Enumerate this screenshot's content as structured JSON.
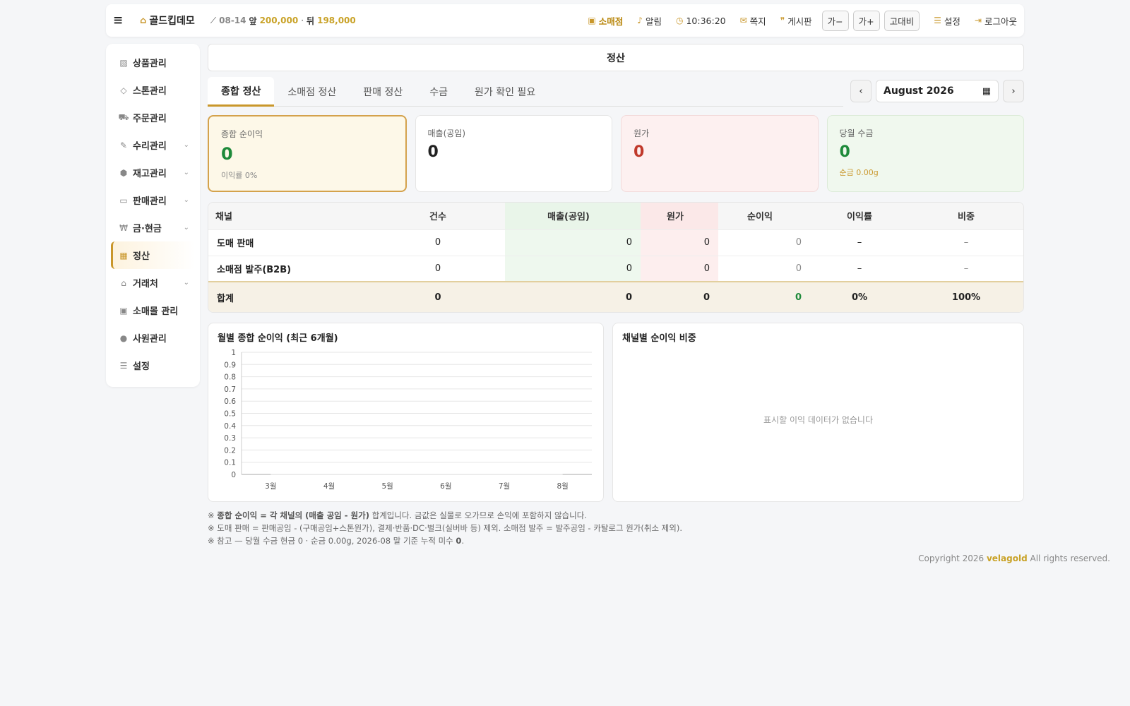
{
  "topbar": {
    "brand": "골드킵데모",
    "ticker": {
      "date": "08-14",
      "front_label": "앞",
      "front_value": "200,000",
      "sep": "·",
      "back_label": "뒤",
      "back_value": "198,000"
    },
    "store": "소매점",
    "alerts": "알림",
    "time": "10:36:20",
    "messages": "쪽지",
    "board": "게시판",
    "font_minus": "가−",
    "font_plus": "가+",
    "contrast": "고대비",
    "settings": "설정",
    "logout": "로그아웃"
  },
  "sidebar": {
    "items": [
      {
        "label": "상품관리",
        "icon": "image-icon",
        "glyph": "▨",
        "expandable": false
      },
      {
        "label": "스톤관리",
        "icon": "gem-icon",
        "glyph": "◇",
        "expandable": false
      },
      {
        "label": "주문관리",
        "icon": "cart-icon",
        "glyph": "⛟",
        "expandable": false
      },
      {
        "label": "수리관리",
        "icon": "wrench-icon",
        "glyph": "✎",
        "expandable": true
      },
      {
        "label": "재고관리",
        "icon": "boxes-icon",
        "glyph": "⬢",
        "expandable": true
      },
      {
        "label": "판매관리",
        "icon": "card-icon",
        "glyph": "▭",
        "expandable": true
      },
      {
        "label": "금·현금",
        "icon": "won-icon",
        "glyph": "₩",
        "expandable": true
      },
      {
        "label": "정산",
        "icon": "calculator-icon",
        "glyph": "▦",
        "expandable": false,
        "active": true
      },
      {
        "label": "거래처",
        "icon": "bank-icon",
        "glyph": "⌂",
        "expandable": true
      },
      {
        "label": "소매몰 관리",
        "icon": "shop-icon",
        "glyph": "▣",
        "expandable": false
      },
      {
        "label": "사원관리",
        "icon": "person-icon",
        "glyph": "●",
        "expandable": false
      },
      {
        "label": "설정",
        "icon": "sliders-icon",
        "glyph": "☰",
        "expandable": false
      }
    ]
  },
  "main": {
    "title": "정산",
    "tabs": [
      "종합 정산",
      "소매점 정산",
      "판매 정산",
      "수금",
      "원가 확인 필요"
    ],
    "month": "August 2026",
    "cards": {
      "net_profit": {
        "label": "종합 순이익",
        "value": "0",
        "sub": "이익률 0%"
      },
      "sales": {
        "label": "매출(공임)",
        "value": "0"
      },
      "cost": {
        "label": "원가",
        "value": "0"
      },
      "collection": {
        "label": "당월 수금",
        "value": "0",
        "sub": "순금 0.00g"
      }
    },
    "table": {
      "headers": [
        "채널",
        "건수",
        "매출(공임)",
        "원가",
        "순이익",
        "이익률",
        "비중"
      ],
      "rows": [
        [
          "도매 판매",
          "0",
          "0",
          "0",
          "0",
          "–",
          "–"
        ],
        [
          "소매점 발주(B2B)",
          "0",
          "0",
          "0",
          "0",
          "–",
          "–"
        ]
      ],
      "total": [
        "합계",
        "0",
        "0",
        "0",
        "0",
        "0%",
        "100%"
      ]
    },
    "pie_title": "채널별 순이익 비중",
    "pie_empty": "표시할 이익 데이터가 없습니다",
    "notes": {
      "n1_prefix": "※ ",
      "n1_bold": "종합 순이익 = 각 채널의 (매출 공임 - 원가)",
      "n1_rest": " 합계입니다. 금값은 실물로 오가므로 손익에 포함하지 않습니다.",
      "n2": "※ 도매 판매 = 판매공임 - (구매공임+스톤원가), 결제·반품·DC·벌크(실버바 등) 제외. 소매점 발주 = 발주공임 - 카탈로그 원가(취소 제외).",
      "n3_text": "※ 참고 — 당월 수금 현금 0 · 순금 0.00g, 2026-08 말 기준 누적 미수 ",
      "n3_bold": "0",
      "n3_end": "."
    }
  },
  "footer": {
    "prefix": "Copyright 2026 ",
    "brand": "velagold",
    "suffix": " All rights reserved."
  },
  "chart_data": {
    "type": "line",
    "title": "월별 종합 순이익 (최근 6개월)",
    "categories": [
      "3월",
      "4월",
      "5월",
      "6월",
      "7월",
      "8월"
    ],
    "values": [
      0,
      0,
      0,
      0,
      0,
      0
    ],
    "ylim": [
      0,
      1
    ],
    "yticks": [
      "0",
      "0.1",
      "0.2",
      "0.3",
      "0.4",
      "0.5",
      "0.6",
      "0.7",
      "0.8",
      "0.9",
      "1"
    ],
    "grid": true,
    "xlabel": "",
    "ylabel": ""
  }
}
